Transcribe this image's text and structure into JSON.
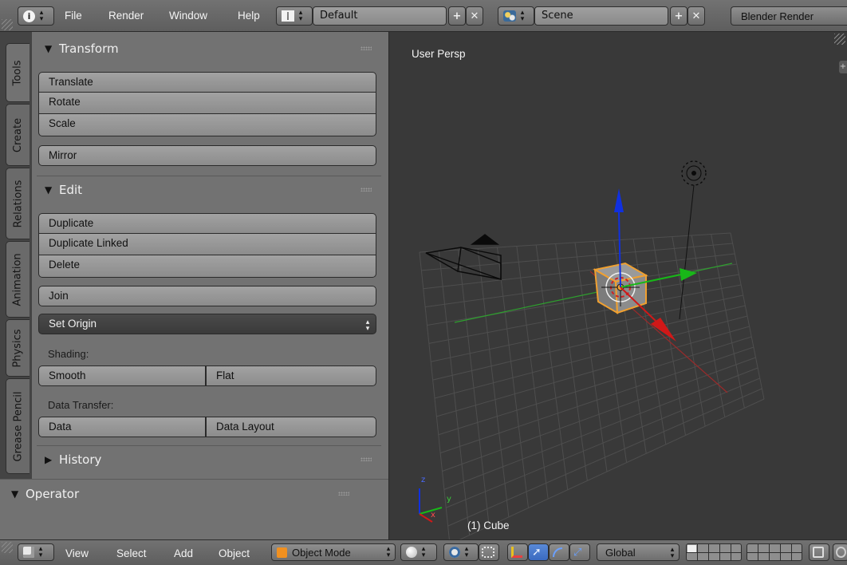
{
  "top_header": {
    "menus": [
      "File",
      "Render",
      "Window",
      "Help"
    ],
    "layout_name": "Default",
    "scene_name": "Scene",
    "render_engine": "Blender Render",
    "info_icon": "info-icon",
    "screen_icon": "screen-layout-icon",
    "scene_icon": "scene-icon"
  },
  "tabs": [
    "Tools",
    "Create",
    "Relations",
    "Animation",
    "Physics",
    "Grease Pencil"
  ],
  "active_tab": "Tools",
  "panels": {
    "transform": {
      "title": "Transform",
      "buttons": [
        "Translate",
        "Rotate",
        "Scale"
      ],
      "mirror": "Mirror"
    },
    "edit": {
      "title": "Edit",
      "buttons": [
        "Duplicate",
        "Duplicate Linked",
        "Delete"
      ],
      "join": "Join",
      "set_origin": "Set Origin",
      "shading_label": "Shading:",
      "shading_smooth": "Smooth",
      "shading_flat": "Flat",
      "data_transfer_label": "Data Transfer:",
      "data_transfer_data": "Data",
      "data_transfer_layout": "Data Layout"
    },
    "history": {
      "title": "History",
      "collapsed": true
    },
    "operator": {
      "title": "Operator"
    }
  },
  "viewport": {
    "view_label": "User Persp",
    "object_label": "(1) Cube",
    "axis_letters": [
      "z",
      "y",
      "x"
    ],
    "colors": {
      "x_axis": "#d01818",
      "y_axis": "#18b818",
      "z_axis": "#1030e0",
      "selected": "#f0a030"
    }
  },
  "bottom_header": {
    "menus": [
      "View",
      "Select",
      "Add",
      "Object"
    ],
    "mode": "Object Mode",
    "orientation": "Global"
  }
}
